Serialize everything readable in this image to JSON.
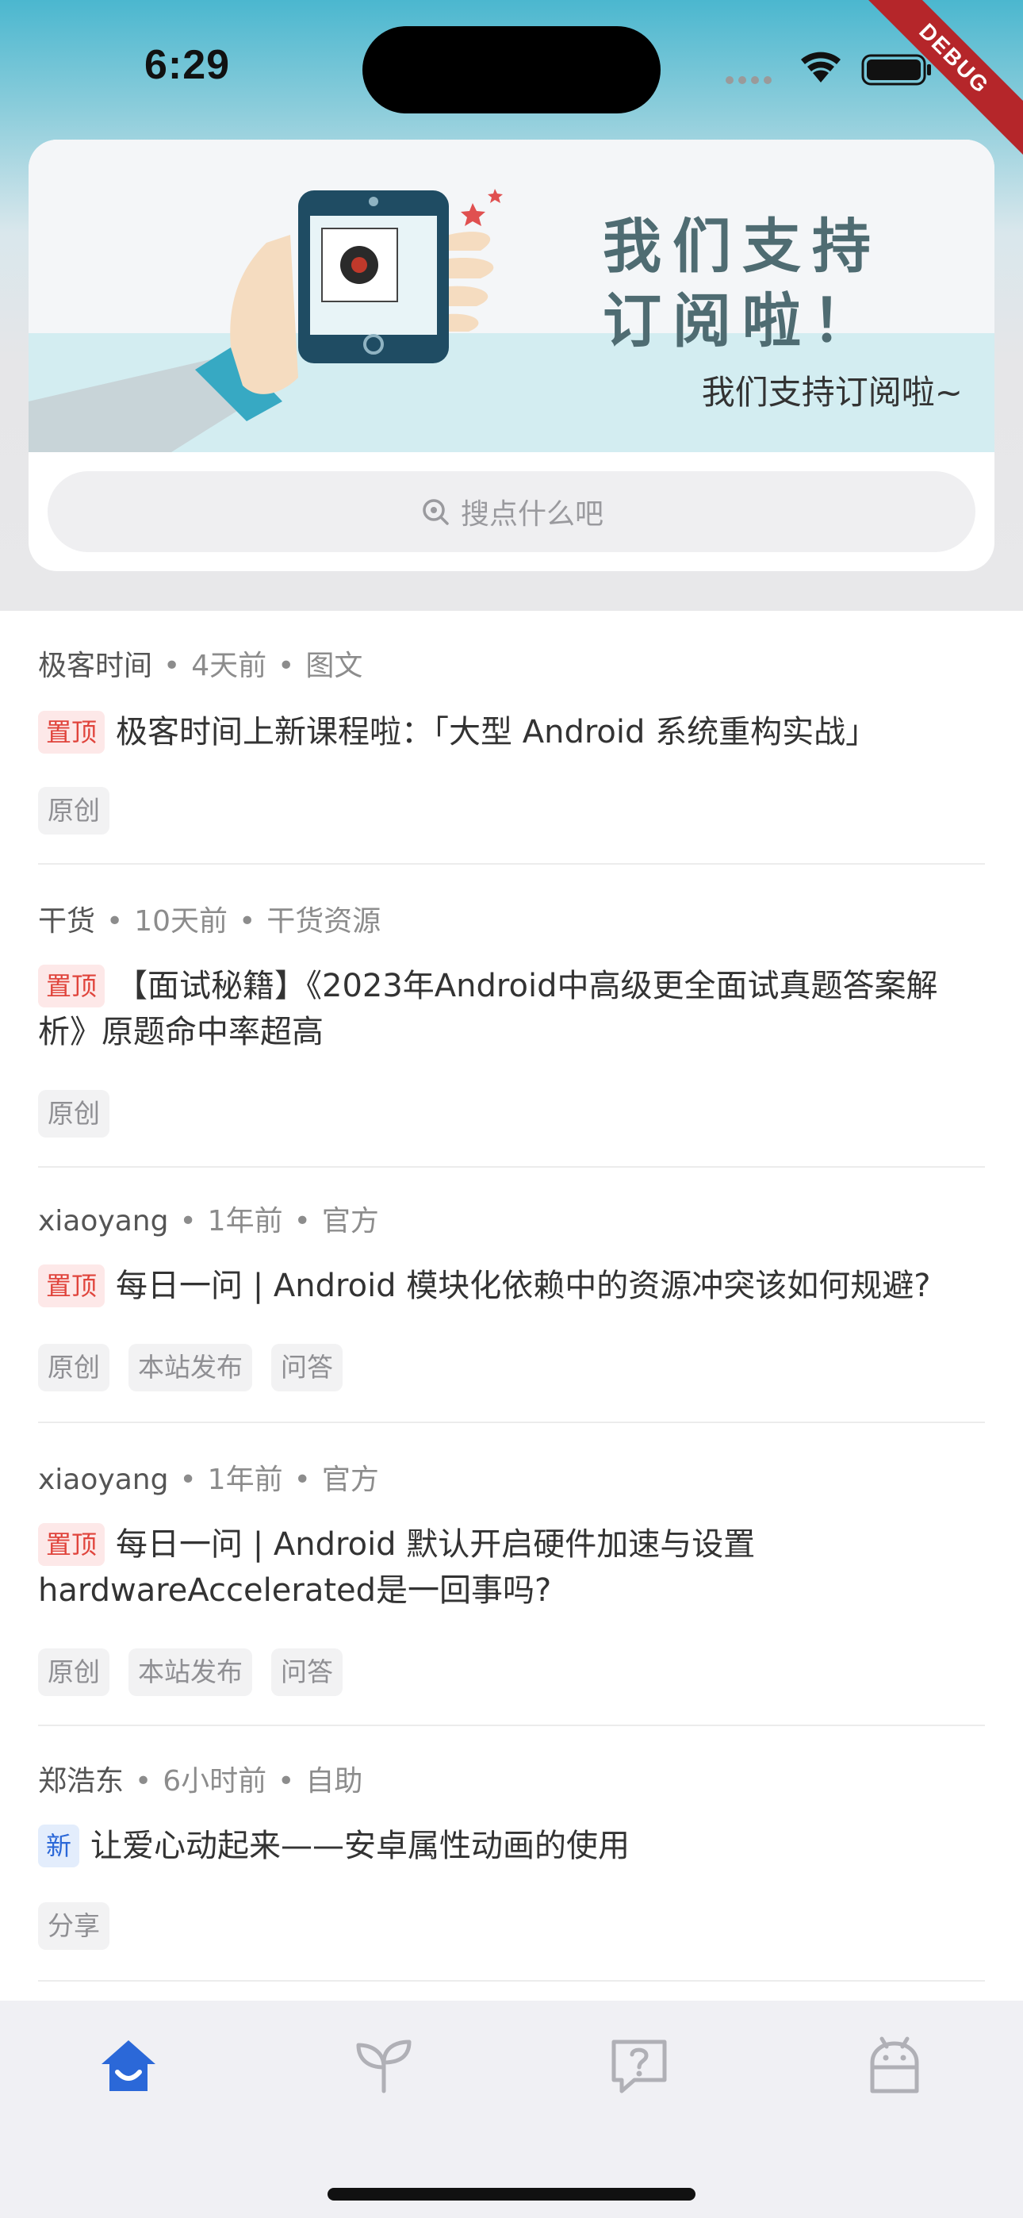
{
  "status_bar": {
    "time": "6:29",
    "debug_label": "DEBUG"
  },
  "banner": {
    "heading_line1": "我们支持",
    "heading_line2": "订阅啦！",
    "subtitle": "我们支持订阅啦~"
  },
  "search": {
    "placeholder": "搜点什么吧"
  },
  "articles": [
    {
      "author": "极客时间",
      "time": "4天前",
      "category": "图文",
      "badge": "置顶",
      "badge_type": "top",
      "title": "极客时间上新课程啦：「大型 Android 系统重构实战」",
      "tags": [
        "原创"
      ]
    },
    {
      "author": "干货",
      "time": "10天前",
      "category": "干货资源",
      "badge": "置顶",
      "badge_type": "top",
      "title": "【面试秘籍】《2023年Android中高级更全面试真题答案解析》原题命中率超高",
      "tags": [
        "原创"
      ]
    },
    {
      "author": "xiaoyang",
      "time": "1年前",
      "category": "官方",
      "badge": "置顶",
      "badge_type": "top",
      "title": "每日一问 | Android 模块化依赖中的资源冲突该如何规避?",
      "tags": [
        "原创",
        "本站发布",
        "问答"
      ]
    },
    {
      "author": "xiaoyang",
      "time": "1年前",
      "category": "官方",
      "badge": "置顶",
      "badge_type": "top",
      "title": "每日一问 | Android 默认开启硬件加速与设置 hardwareAccelerated是一回事吗?",
      "tags": [
        "原创",
        "本站发布",
        "问答"
      ]
    },
    {
      "author": "郑浩东",
      "time": "6小时前",
      "category": "自助",
      "badge": "新",
      "badge_type": "new",
      "title": "让爱心动起来——安卓属性动画的使用",
      "tags": [
        "分享"
      ]
    }
  ],
  "bottom_nav": [
    {
      "icon": "home-icon",
      "active": true
    },
    {
      "icon": "sprout-icon",
      "active": false
    },
    {
      "icon": "question-icon",
      "active": false
    },
    {
      "icon": "android-icon",
      "active": false
    }
  ],
  "colors": {
    "accent": "#2b68d8",
    "top_badge": "#e0443c",
    "nav_inactive": "#b0b0b6"
  }
}
